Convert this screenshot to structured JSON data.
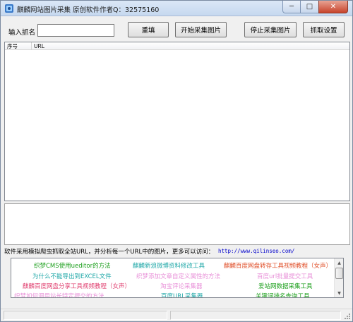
{
  "window": {
    "title": "麒麟网站图片采集 原创软件作者Q：32575160",
    "controls": {
      "minimize": "─",
      "maximize": "□",
      "close": "✕"
    }
  },
  "toolbar": {
    "keyword_label": "输入抓名",
    "keyword_value": "",
    "reset_label": "重填",
    "start_label": "开始采集图片",
    "stop_label": "停止采集图片",
    "settings_label": "抓取设置"
  },
  "results_list": {
    "columns": [
      "序号",
      "URL"
    ],
    "rows": []
  },
  "notice": {
    "text": "软件采用模拟爬虫抓取全站URL，并分析每一个URL中的图片，更多可以访问：",
    "url": "http://www.qilinseo.com/"
  },
  "promo_links": [
    {
      "text": "织梦CMS使用ueditor的方法",
      "color": "#1a9e1a"
    },
    {
      "text": "麒麟新浪微博资料修改工具",
      "color": "#20a8a8"
    },
    {
      "text": "麒麟百度网盘转存工具视频教程（女声）",
      "color": "#e0502a"
    },
    {
      "text": "为什么不能导出到EXCEL文件",
      "color": "#20a8a8"
    },
    {
      "text": "织梦添加文章自定义属性的方法",
      "color": "#e890d8"
    },
    {
      "text": "百度url批量提交工具",
      "color": "#e890d8"
    },
    {
      "text": "麒麟百度网盘分享工具视频教程（女声）",
      "color": "#e04070"
    },
    {
      "text": "淘宝评论采集器",
      "color": "#e890d8"
    },
    {
      "text": "爱站网数据采集工具",
      "color": "#1a9e1a"
    },
    {
      "text": "织梦如何调用站长特定提交的方法",
      "color": "#e890d8"
    },
    {
      "text": "百度URL采集器",
      "color": "#20a8a8"
    },
    {
      "text": "关键词排名查询工具",
      "color": "#1a9e1a"
    }
  ],
  "icons": {
    "app": "app-icon",
    "scroll_up": "scroll-up-icon",
    "scroll_down": "scroll-down-icon",
    "resize_grip": "resize-grip-icon"
  }
}
